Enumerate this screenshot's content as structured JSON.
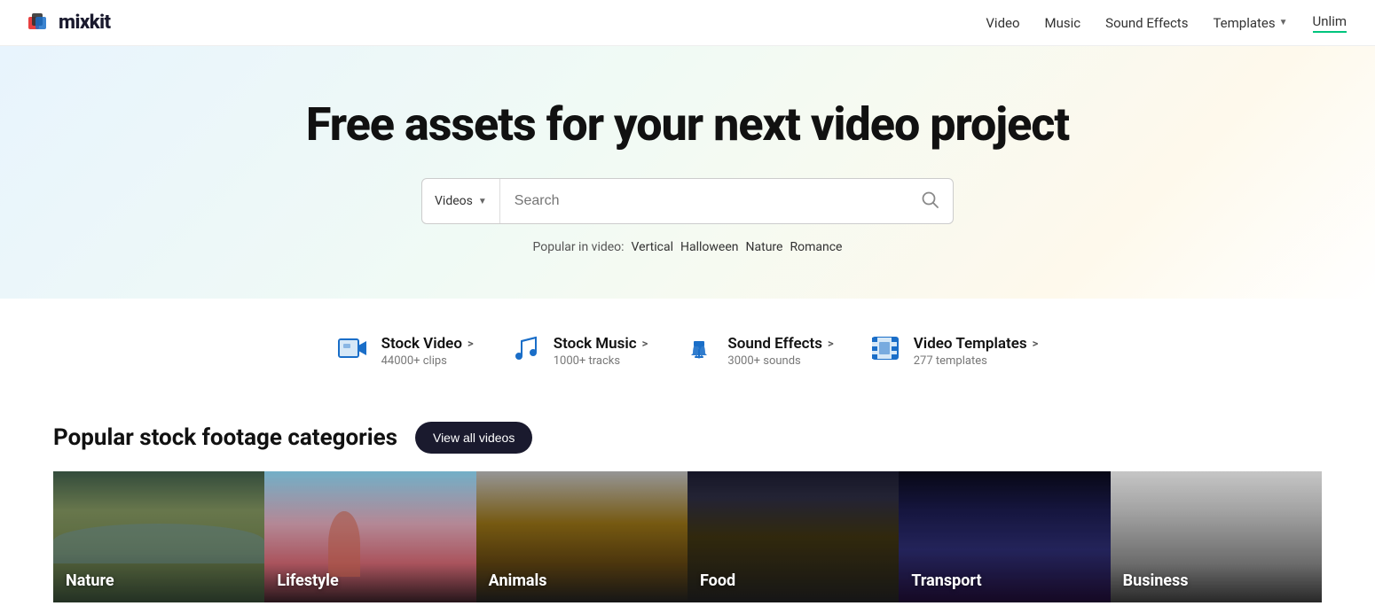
{
  "header": {
    "logo_text": "mixkit",
    "nav": [
      {
        "label": "Video",
        "id": "nav-video"
      },
      {
        "label": "Music",
        "id": "nav-music"
      },
      {
        "label": "Sound Effects",
        "id": "nav-sound-effects"
      },
      {
        "label": "Templates",
        "id": "nav-templates",
        "has_arrow": true
      },
      {
        "label": "Unlim",
        "id": "nav-unlim",
        "underline": true
      }
    ]
  },
  "hero": {
    "title": "Free assets for your next video project",
    "search": {
      "dropdown_label": "Videos",
      "placeholder": "Search",
      "icon": "🔍"
    },
    "popular": {
      "prefix": "Popular in video:",
      "tags": [
        "Vertical",
        "Halloween",
        "Nature",
        "Romance"
      ]
    }
  },
  "asset_categories": [
    {
      "icon": "📹",
      "title": "Stock Video",
      "arrow": ">",
      "subtitle": "44000+ clips"
    },
    {
      "icon": "🎵",
      "title": "Stock Music",
      "arrow": ">",
      "subtitle": "1000+ tracks"
    },
    {
      "icon": "🔔",
      "title": "Sound Effects",
      "arrow": ">",
      "subtitle": "3000+ sounds"
    },
    {
      "icon": "🎬",
      "title": "Video Templates",
      "arrow": ">",
      "subtitle": "277 templates"
    }
  ],
  "popular_section": {
    "title": "Popular stock footage categories",
    "view_all_btn": "View all videos",
    "thumbnails": [
      {
        "label": "Nature",
        "class": "thumb-nature"
      },
      {
        "label": "Lifestyle",
        "class": "thumb-lifestyle"
      },
      {
        "label": "Animals",
        "class": "thumb-animals"
      },
      {
        "label": "Food",
        "class": "thumb-food"
      },
      {
        "label": "Transport",
        "class": "thumb-transport"
      },
      {
        "label": "Business",
        "class": "thumb-business"
      }
    ]
  }
}
